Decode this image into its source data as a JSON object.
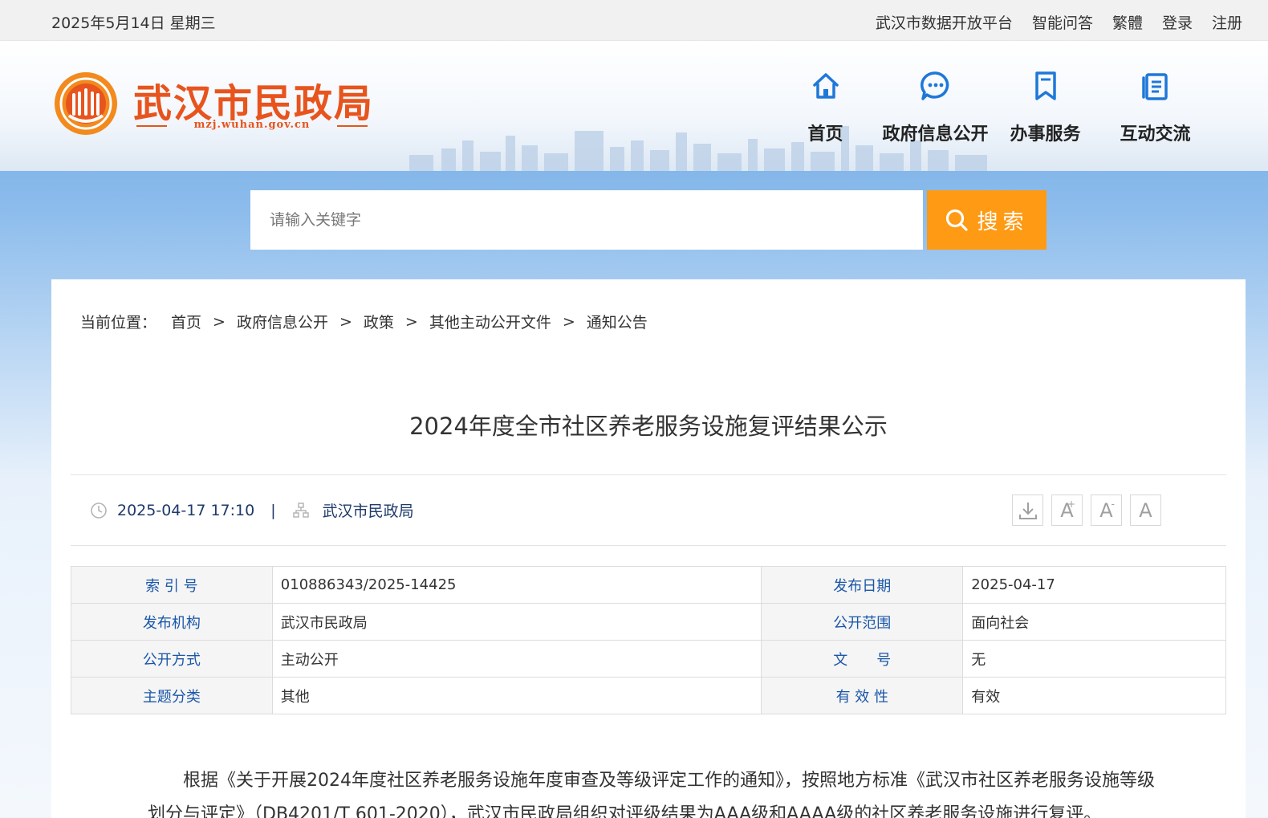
{
  "topbar": {
    "date": "2025年5月14日 星期三",
    "links": [
      "武汉市数据开放平台",
      "智能问答",
      "繁體",
      "登录",
      "注册"
    ]
  },
  "header": {
    "logo_title": "武汉市民政局",
    "logo_domain": "mzj.wuhan.gov.cn",
    "nav": [
      {
        "label": "首页",
        "icon": "home-icon"
      },
      {
        "label": "政府信息公开",
        "icon": "chat-icon"
      },
      {
        "label": "办事服务",
        "icon": "bookmark-icon"
      },
      {
        "label": "互动交流",
        "icon": "document-icon"
      }
    ]
  },
  "search": {
    "placeholder": "请输入关键字",
    "button_label": "搜索"
  },
  "breadcrumb": {
    "prefix": "当前位置：",
    "items": [
      "首页",
      "政府信息公开",
      "政策",
      "其他主动公开文件",
      "通知公告"
    ],
    "separator": ">"
  },
  "article": {
    "title": "2024年度全市社区养老服务设施复评结果公示",
    "published": "2025-04-17 17:10",
    "publisher": "武汉市民政局",
    "divider": "|",
    "tools": {
      "increase": "A",
      "decrease": "A",
      "reset": "A",
      "plus_mark": "+",
      "minus_mark": "-"
    }
  },
  "info_table": {
    "rows": [
      {
        "k1": "索 引 号",
        "v1": "010886343/2025-14425",
        "k2": "发布日期",
        "v2": "2025-04-17"
      },
      {
        "k1": "发布机构",
        "v1": "武汉市民政局",
        "k2": "公开范围",
        "v2": "面向社会"
      },
      {
        "k1": "公开方式",
        "v1": "主动公开",
        "k2": "文　　号",
        "v2": "无"
      },
      {
        "k1": "主题分类",
        "v1": "其他",
        "k2": "有 效 性",
        "v2": "有效"
      }
    ]
  },
  "content": {
    "paragraph": "根据《关于开展2024年度社区养老服务设施年度审查及等级评定工作的通知》，按照地方标准《武汉市社区养老服务设施等级划分与评定》（DB4201/T 601-2020），武汉市民政局组织对评级结果为AAA级和AAAA级的社区养老服务设施进行复评。"
  },
  "colors": {
    "accent": "#ff9a14",
    "brand": "#e8541d",
    "link": "#1a56a8"
  }
}
